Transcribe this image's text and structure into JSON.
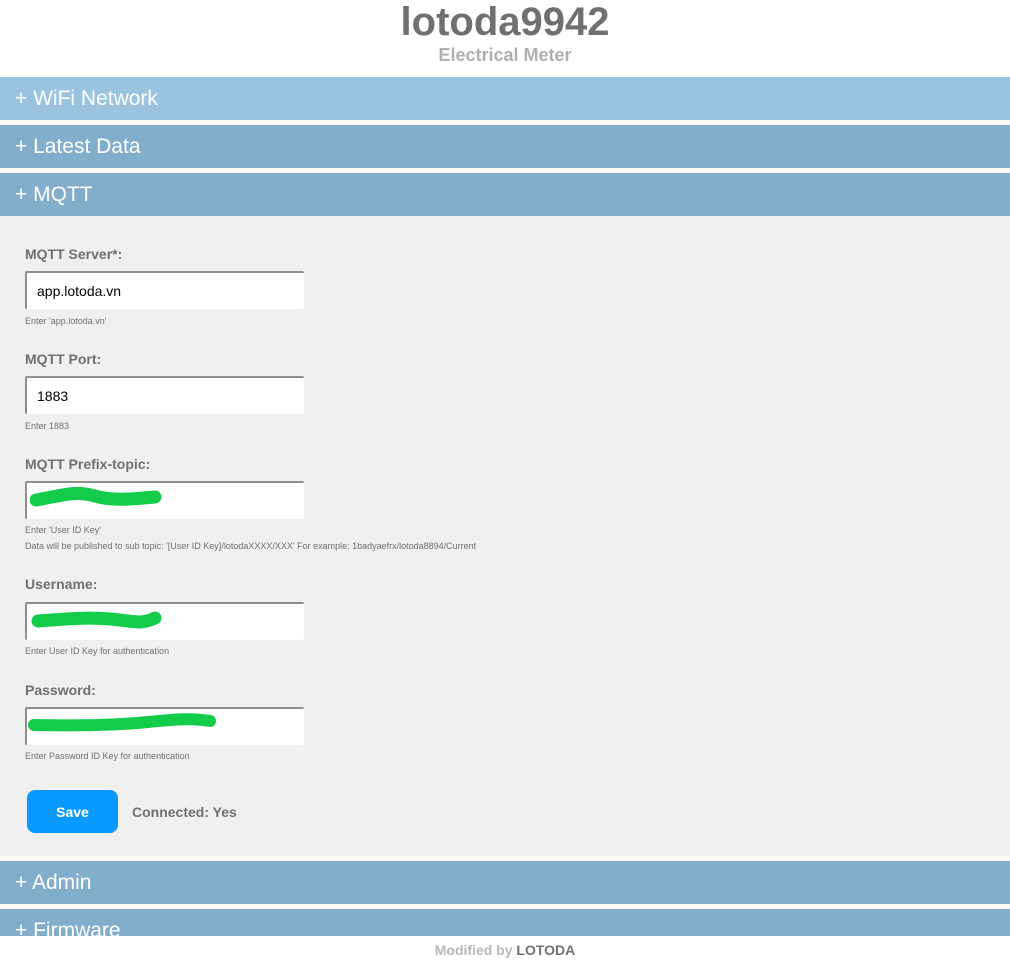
{
  "header": {
    "title": "lotoda9942",
    "subtitle": "Electrical Meter"
  },
  "sections": [
    {
      "label": "+ WiFi Network"
    },
    {
      "label": "+ Latest Data"
    },
    {
      "label": "+ MQTT"
    },
    {
      "label": "+ Admin"
    },
    {
      "label": "+ Firmware"
    }
  ],
  "colors": {
    "section_bar": "#82aecc",
    "section_bar_hover": "#9ac3e0",
    "panel": "#f0f0f0",
    "save_button": "#0a99ff",
    "redaction": "#12cc4a"
  },
  "mqtt": {
    "server": {
      "label": "MQTT Server*:",
      "value": "app.lotoda.vn",
      "hint": "Enter 'app.lotoda.vn'"
    },
    "port": {
      "label": "MQTT Port:",
      "value": "1883",
      "hint": "Enter 1883"
    },
    "prefix": {
      "label": "MQTT Prefix-topic:",
      "hint": "Enter 'User ID Key'",
      "hint2": "Data will be published to sub topic: '[User ID Key]/lotodaXXXX/XXX' For example: 1badyaefrx/lotoda8894/Current"
    },
    "username": {
      "label": "Username:",
      "hint": "Enter User ID Key for authentication"
    },
    "password": {
      "label": "Password:",
      "hint": "Enter Password ID Key for authentication"
    },
    "save_label": "Save",
    "status": "Connected: Yes"
  },
  "footer": {
    "prefix": "Modified by",
    "brand": "LOTODA"
  }
}
